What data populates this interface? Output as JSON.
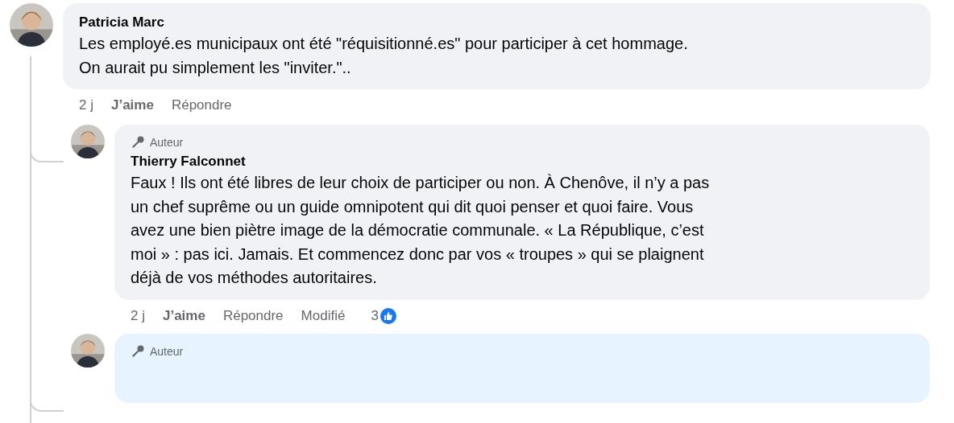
{
  "comment": {
    "author": "Patricia Marc",
    "lines": [
      "Les employé.es municipaux ont été \"réquisitionné.es\" pour participer à cet hommage.",
      "On aurait pu simplement les \"inviter.\".."
    ],
    "actions": [
      "2 j",
      "J’aime",
      "Répondre"
    ]
  },
  "replies": [
    {
      "badge": "Auteur",
      "color": "#f0f2f5",
      "author": "Thierry Falconnet",
      "lines": [
        "Faux ! Ils ont été libres de leur choix de participer ou non. À Chenôve, il n’y a pas",
        "un chef suprême ou un guide omnipotent qui dit quoi penser et quoi faire. Vous",
        "avez une bien piètre image de la démocratie communale. « La République, c’est",
        "moi » : pas ici. Jamais. Et commencez donc par vos « troupes » qui se plaignent",
        "déjà de vos méthodes autoritaires."
      ],
      "actions": [
        "2 j",
        "J’aime",
        "Répondre",
        "Modifié"
      ],
      "reaction_count": "3"
    },
    {
      "badge": "Auteur",
      "color": "#e7f3ff"
    }
  ]
}
